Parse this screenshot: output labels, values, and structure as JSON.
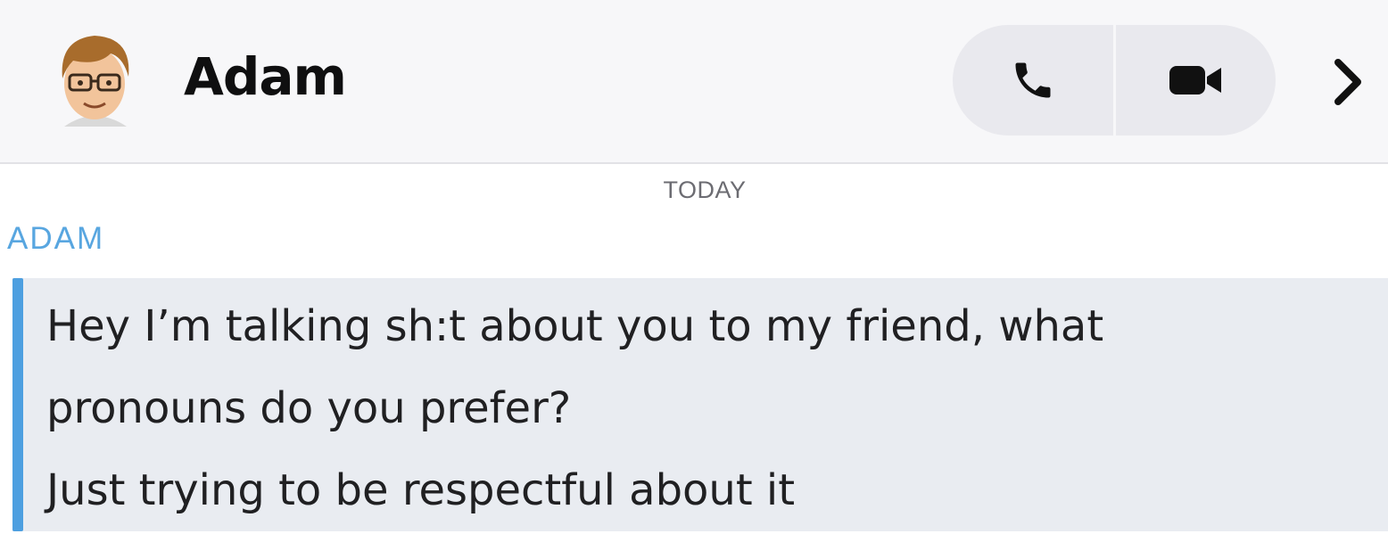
{
  "header": {
    "contact_name": "Adam",
    "avatar_icon": "bitmoji-avatar-icon",
    "audio_call_icon": "phone-icon",
    "video_call_icon": "video-camera-icon",
    "more_icon": "chevron-right-icon"
  },
  "conversation": {
    "date_divider": "TODAY",
    "sender_label": "ADAM",
    "message_lines": [
      "Hey I’m talking sh:t about you to my friend, what",
      "pronouns do you prefer?",
      "Just trying to be respectful about it"
    ]
  },
  "colors": {
    "accent": "#4d9fe0",
    "sender_label": "#58a6e0",
    "message_bg": "#e9ecf1"
  }
}
